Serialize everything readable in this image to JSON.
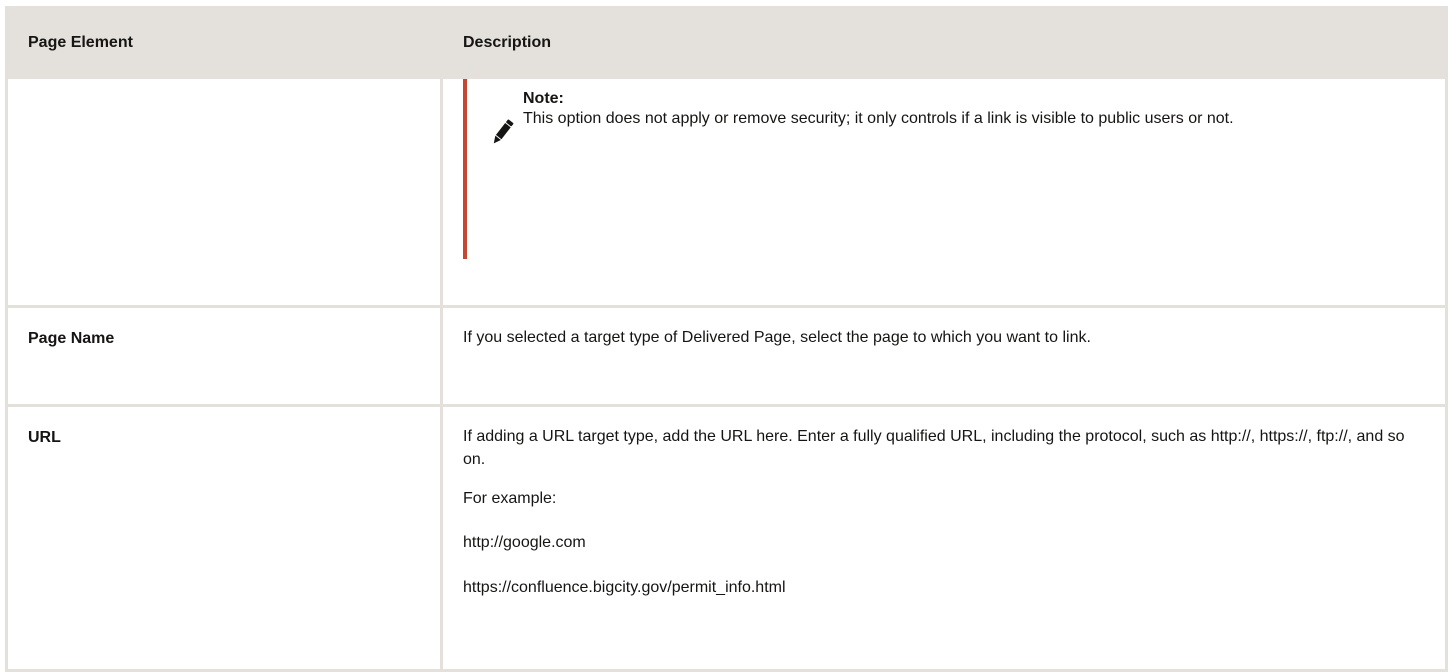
{
  "table": {
    "headers": {
      "element": "Page Element",
      "description": "Description"
    },
    "note": {
      "title": "Note:",
      "text": "This option does not apply or remove security; it only controls if a link is visible to public users or not.",
      "icon": "pencil-icon",
      "accent_color": "#c74634"
    },
    "rows": [
      {
        "element": "Page Name",
        "description": "If you selected a target type of Delivered Page, select the page to which you want to link."
      },
      {
        "element": "URL",
        "description": "If adding a URL target type, add the URL here. Enter a fully qualified URL, including the protocol, such as http://, https://, ftp://, and so on.",
        "example_label": "For example:",
        "examples": [
          "http://google.com",
          "https://confluence.bigcity.gov/permit_info.html"
        ]
      }
    ]
  }
}
